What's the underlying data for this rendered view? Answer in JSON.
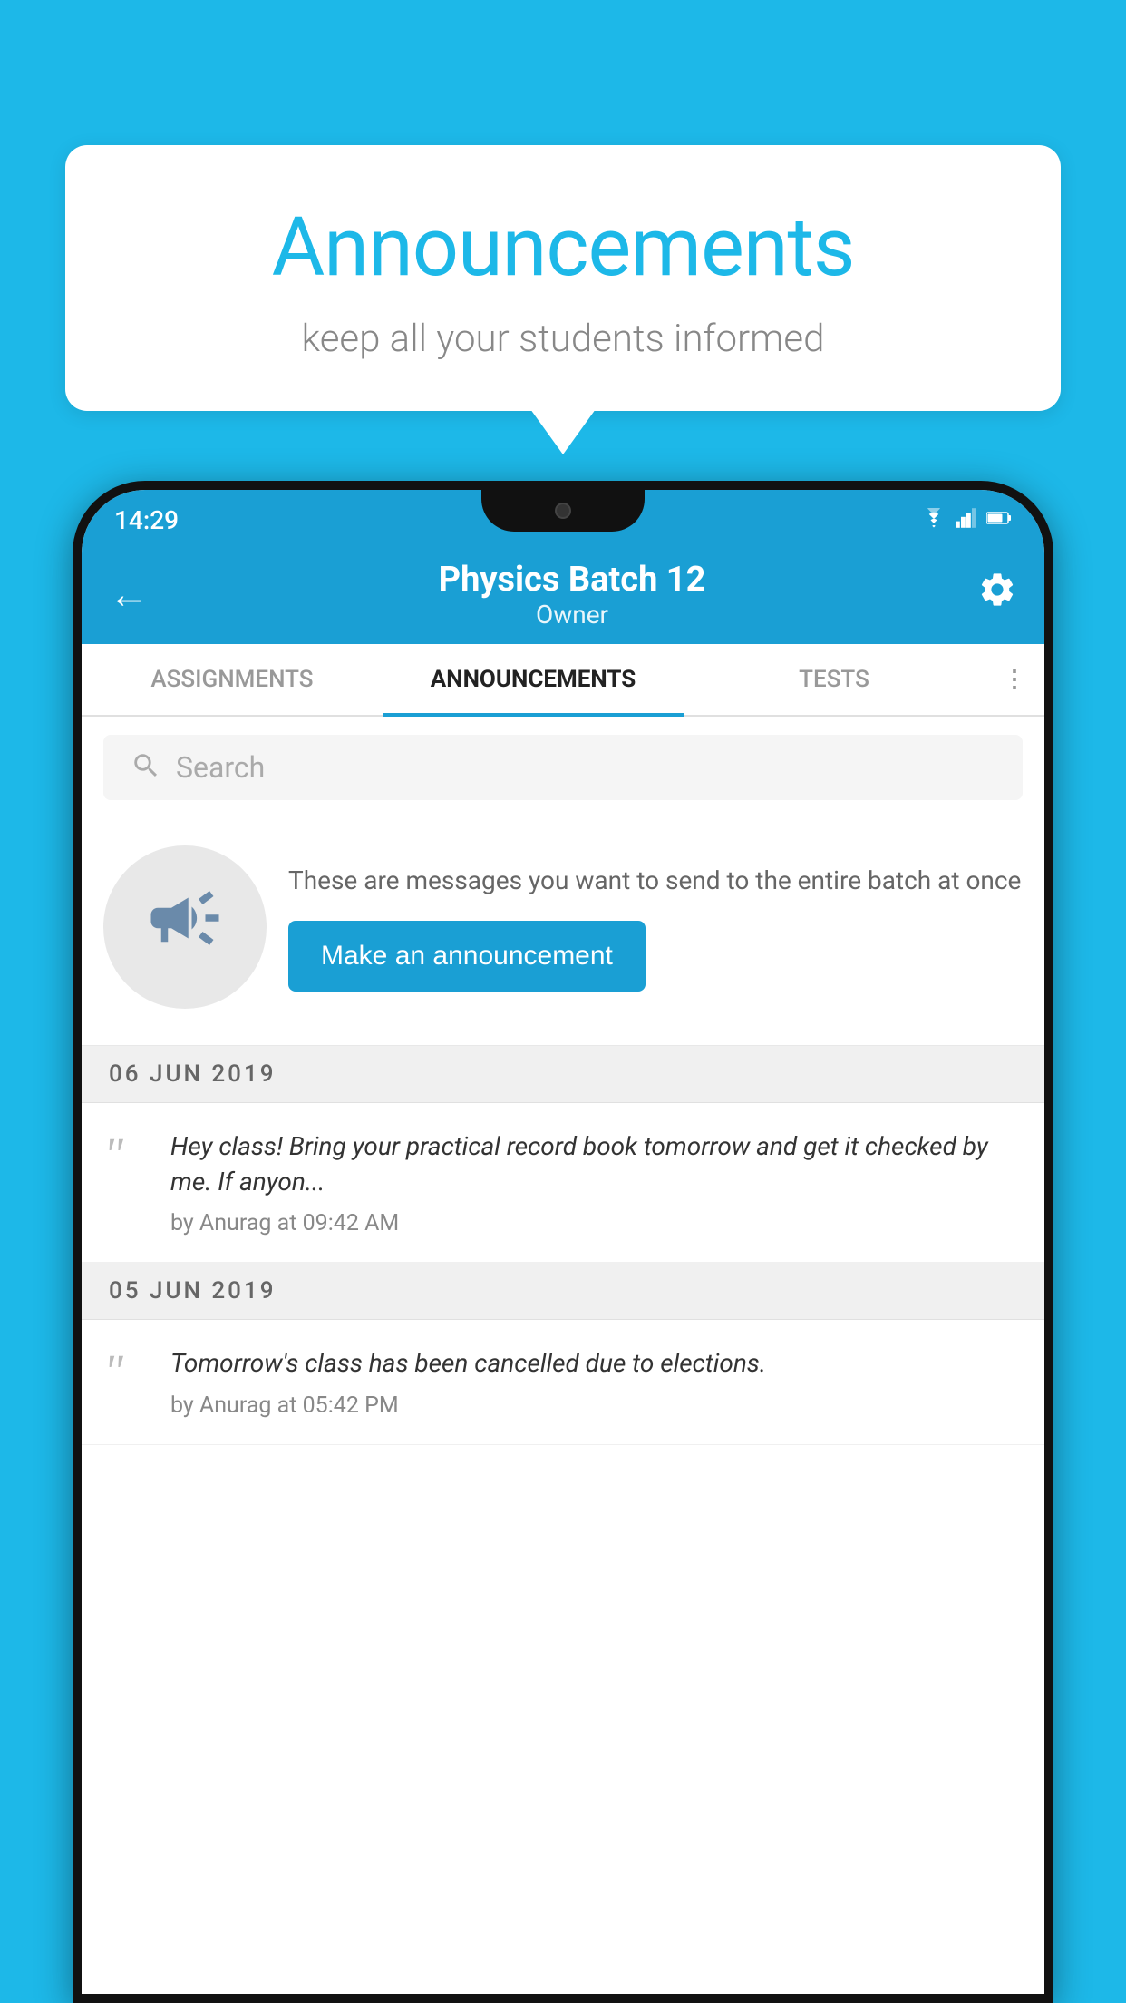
{
  "background_color": "#1db8e8",
  "speech_bubble": {
    "title": "Announcements",
    "subtitle": "keep all your students informed"
  },
  "status_bar": {
    "time": "14:29",
    "wifi": "▼",
    "signal": "▲",
    "battery": "▐"
  },
  "app_bar": {
    "back_label": "←",
    "title": "Physics Batch 12",
    "subtitle": "Owner",
    "settings_label": "⚙"
  },
  "tabs": [
    {
      "label": "ASSIGNMENTS",
      "active": false
    },
    {
      "label": "ANNOUNCEMENTS",
      "active": true
    },
    {
      "label": "TESTS",
      "active": false
    }
  ],
  "tab_more": "⋮",
  "search": {
    "placeholder": "Search"
  },
  "promo": {
    "description": "These are messages you want to send to the entire batch at once",
    "button_label": "Make an announcement"
  },
  "announcements": [
    {
      "date": "06  JUN  2019",
      "text": "Hey class! Bring your practical record book tomorrow and get it checked by me. If anyon...",
      "meta": "by Anurag at 09:42 AM"
    },
    {
      "date": "05  JUN  2019",
      "text": "Tomorrow's class has been cancelled due to elections.",
      "meta": "by Anurag at 05:42 PM"
    }
  ]
}
